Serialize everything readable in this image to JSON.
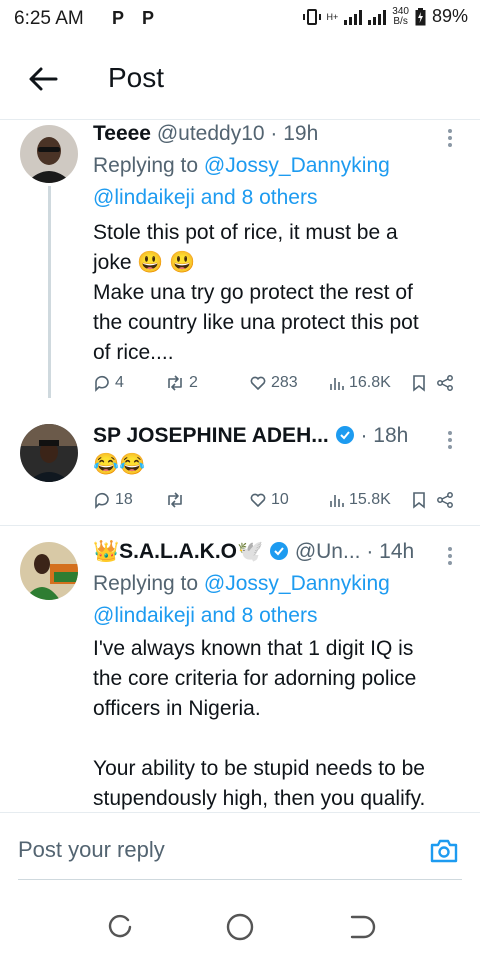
{
  "status_bar": {
    "time": "6:25 AM",
    "notif_icons": [
      "P",
      "P"
    ],
    "net_speed_value": "340",
    "net_speed_unit": "B/s",
    "battery": "89%",
    "hplus": "H+"
  },
  "header": {
    "title": "Post"
  },
  "posts": [
    {
      "name": "Teeee",
      "handle": "@uteddy10",
      "time": "19h",
      "replying_prefix": "Replying to",
      "replying_mention": "@Jossy_Dannyking",
      "replying_more": "@lindaikeji and 8 others",
      "text_line1": "Stole this pot of rice, it must be a",
      "text_line2": "joke 😃 😃",
      "text_line3": "Make una try go protect the rest of",
      "text_line4": "the country like una protect this pot",
      "text_line5": "of rice....",
      "replies": "4",
      "reposts": "2",
      "likes": "283",
      "views": "16.8K"
    },
    {
      "name": "SP JOSEPHINE ADEH...",
      "time": "18h",
      "text_line1": "😂😂",
      "replies": "18",
      "reposts": "",
      "likes": "10",
      "views": "15.8K"
    },
    {
      "name": "👑S.A.L.A.K.O🕊️",
      "handle": "@Un...",
      "time": "14h",
      "replying_prefix": "Replying to",
      "replying_mention": "@Jossy_Dannyking",
      "replying_more": "@lindaikeji and 8 others",
      "text_line1": "I've always known that 1 digit IQ is",
      "text_line2": "the core criteria for adorning police",
      "text_line3": "officers in Nigeria.",
      "text_line4": "Your ability to be stupid needs to be",
      "text_line5": "stupendously high, then you qualify."
    }
  ],
  "reply_box": {
    "placeholder": "Post your reply"
  },
  "colors": {
    "link": "#1d9bf0",
    "verified": "#1d9bf0",
    "muted": "#536471"
  }
}
